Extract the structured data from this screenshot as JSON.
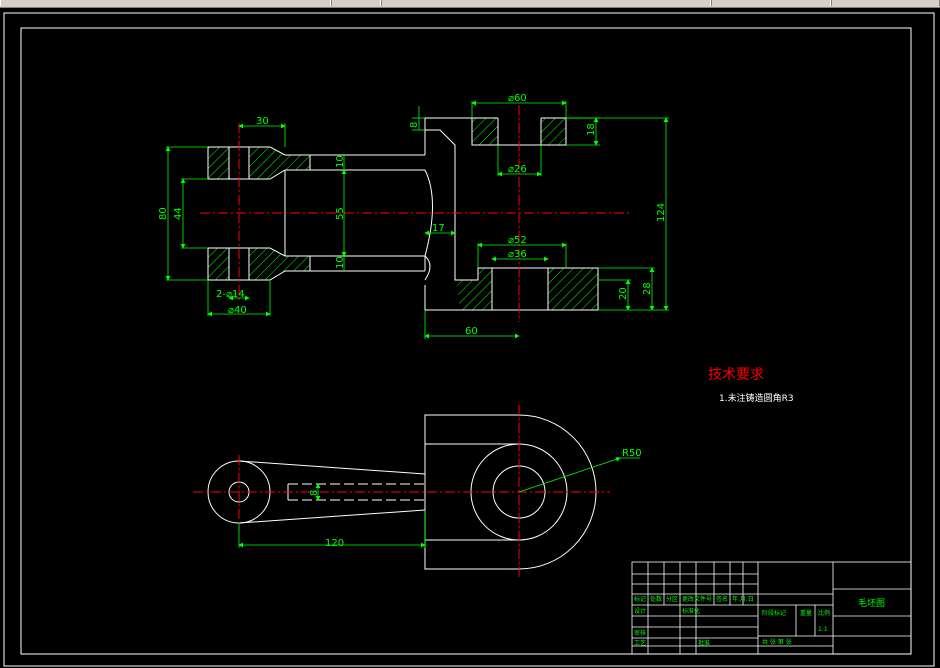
{
  "colors": {
    "background": "#000000",
    "outline": "#ffffff",
    "dimension": "#00ff00",
    "centerline": "#ff0000",
    "hatch": "#00ff00",
    "title_text": "#ff0000",
    "note_text": "#ffffff",
    "titleblock": "#00ff00"
  },
  "dimensions": {
    "d30": "30",
    "d80": "80",
    "d44": "44",
    "d10a": "10",
    "d55": "55",
    "d10b": "10",
    "d2phi14": "2-⌀14",
    "dphi40": "⌀40",
    "d8": "8",
    "dphi60": "⌀60",
    "d18": "18",
    "dphi26": "⌀26",
    "d124": "124",
    "d17": "17",
    "dphi52": "⌀52",
    "dphi36": "⌀36",
    "d20": "20",
    "d28": "28",
    "d60": "60",
    "dR50": "R50",
    "d120": "120",
    "d8b": "8"
  },
  "notes": {
    "title": "技术要求",
    "line1": "1.未注铸造圆角R3"
  },
  "titleblock": {
    "drawing_name": "毛坯图",
    "row_labels_a": [
      "标记",
      "处数",
      "分区",
      "更改文件号",
      "签名",
      "年.月.日"
    ],
    "designer": "设计",
    "standardization": "标准化",
    "stage_mark": "阶段标记",
    "weight": "重量",
    "scale_label": "比例",
    "scale": "1:1",
    "reviewer": "审核",
    "process": "工艺",
    "approve": "批准",
    "sheets": "共 张 第 张"
  }
}
